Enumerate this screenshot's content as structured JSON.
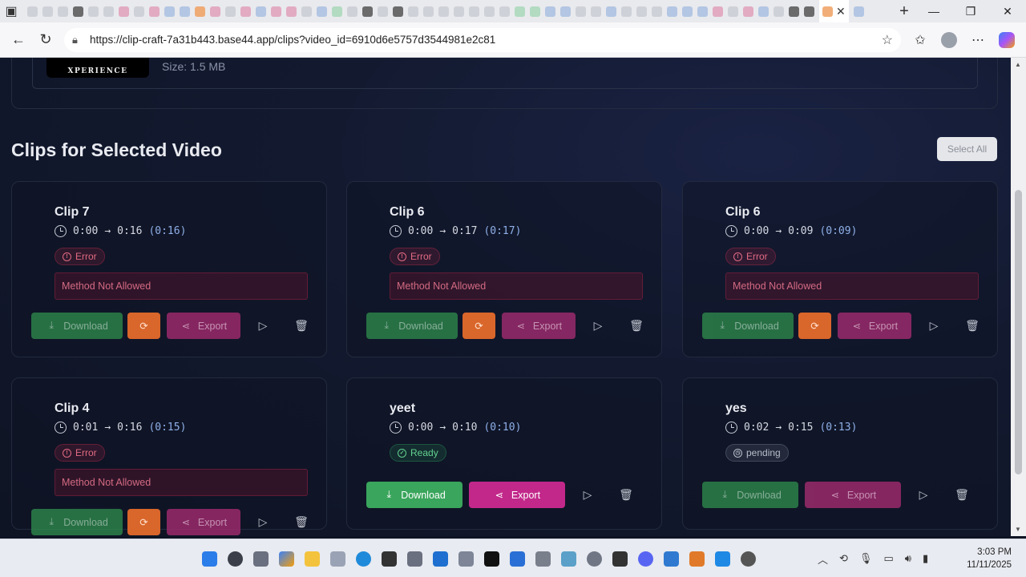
{
  "browser": {
    "url": "https://clip-craft-7a31b443.base44.app/clips?video_id=6910d6e5757d3544981e2c81"
  },
  "video": {
    "thumb_text": "XPERIENCE",
    "size": "Size: 1.5 MB"
  },
  "section": {
    "title": "Clips for Selected Video",
    "select_all": "Select All"
  },
  "buttons": {
    "download": "Download",
    "export": "Export"
  },
  "clips": [
    {
      "title": "Clip 7",
      "start": "0:00",
      "end": "0:16",
      "duration": "(0:16)",
      "status": "Error",
      "error": "Method Not Allowed"
    },
    {
      "title": "Clip 6",
      "start": "0:00",
      "end": "0:17",
      "duration": "(0:17)",
      "status": "Error",
      "error": "Method Not Allowed"
    },
    {
      "title": "Clip 6",
      "start": "0:00",
      "end": "0:09",
      "duration": "(0:09)",
      "status": "Error",
      "error": "Method Not Allowed"
    },
    {
      "title": "Clip 4",
      "start": "0:01",
      "end": "0:16",
      "duration": "(0:15)",
      "status": "Error",
      "error": "Method Not Allowed"
    },
    {
      "title": "yeet",
      "start": "0:00",
      "end": "0:10",
      "duration": "(0:10)",
      "status": "Ready",
      "error": ""
    },
    {
      "title": "yes",
      "start": "0:02",
      "end": "0:15",
      "duration": "(0:13)",
      "status": "pending",
      "error": ""
    }
  ],
  "taskbar": {
    "time": "3:03 PM",
    "date": "11/11/2025"
  }
}
